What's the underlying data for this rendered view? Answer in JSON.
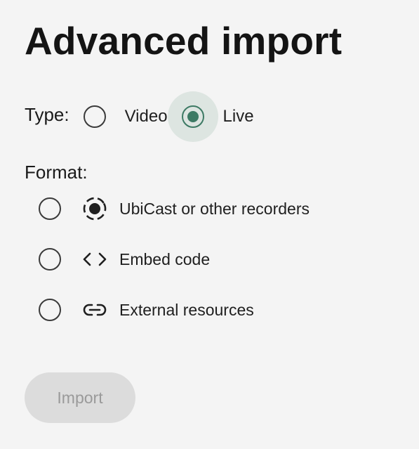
{
  "title": "Advanced import",
  "type": {
    "label": "Type:",
    "options": [
      {
        "label": "Video",
        "selected": false
      },
      {
        "label": "Live",
        "selected": true
      }
    ]
  },
  "format": {
    "label": "Format:",
    "options": [
      {
        "label": "UbiCast or other recorders",
        "icon": "recorder-icon",
        "selected": false
      },
      {
        "label": "Embed code",
        "icon": "code-icon",
        "selected": false
      },
      {
        "label": "External resources",
        "icon": "link-icon",
        "selected": false
      }
    ]
  },
  "import_button": {
    "label": "Import",
    "disabled": true
  },
  "colors": {
    "accent": "#3d7a64",
    "accent_halo": "#dde5e1",
    "background": "#f4f4f4",
    "button_disabled_bg": "#dcdcdc",
    "button_disabled_text": "#9a9a9a"
  }
}
